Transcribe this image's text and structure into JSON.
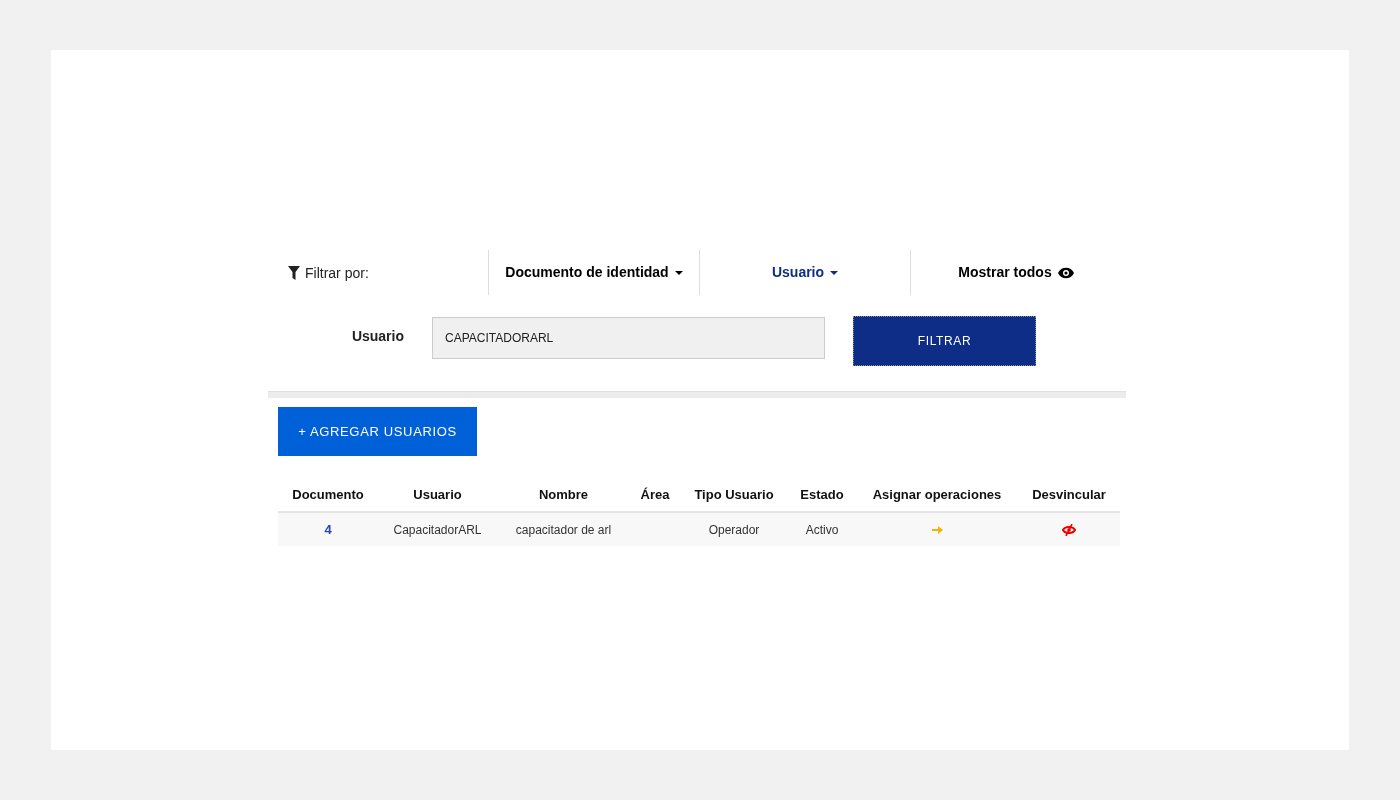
{
  "filter_bar": {
    "label": "Filtrar por:",
    "options": [
      {
        "kind": "dropdown",
        "label": "Documento de identidad",
        "selected": false
      },
      {
        "kind": "dropdown",
        "label": "Usuario",
        "selected": true
      },
      {
        "kind": "show_all",
        "label": "Mostrar todos",
        "selected": false
      }
    ]
  },
  "filter_form": {
    "label": "Usuario",
    "value": "CAPACITADORARL",
    "button": "FILTRAR"
  },
  "add_button": "+ AGREGAR USUARIOS",
  "table": {
    "columns": [
      "Documento",
      "Usuario",
      "Nombre",
      "Área",
      "Tipo Usuario",
      "Estado",
      "Asignar operaciones",
      "Desvincular"
    ],
    "rows": [
      {
        "document": "4",
        "user": "CapacitadorARL",
        "name": "capacitador de arl",
        "type": "Operador",
        "status": "Activo"
      }
    ]
  }
}
